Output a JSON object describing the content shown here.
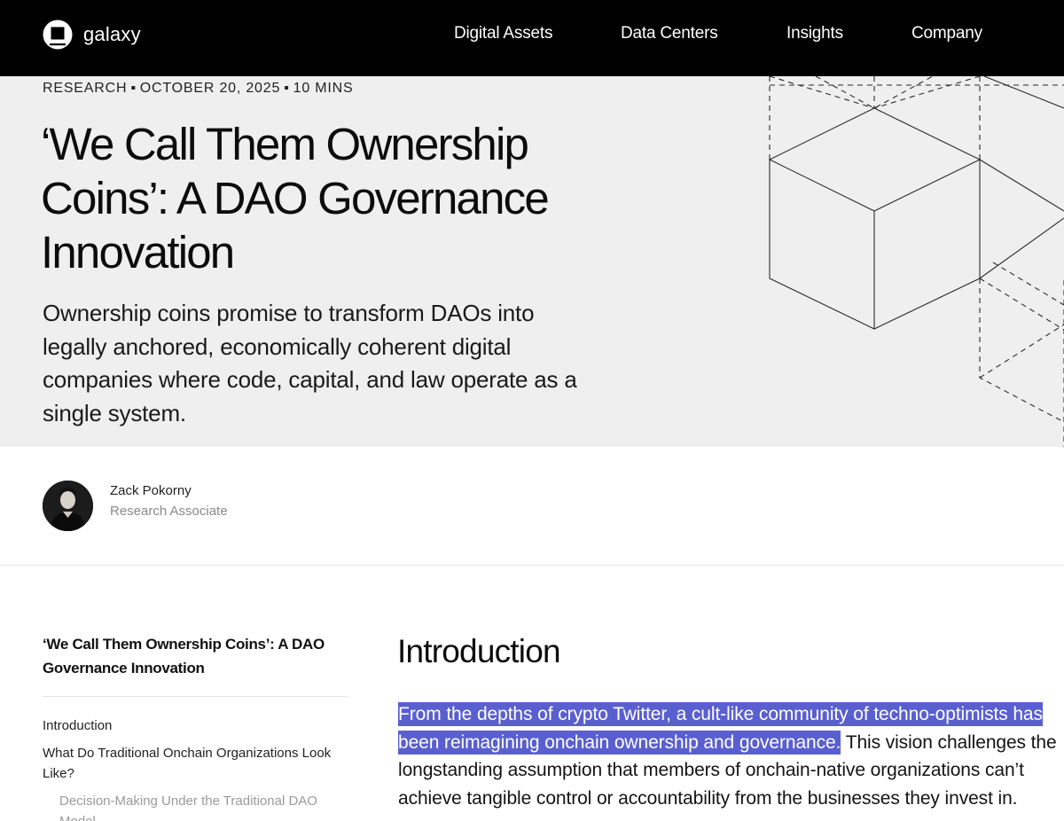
{
  "nav": {
    "brand": "galaxy",
    "links": [
      "Digital Assets",
      "Data Centers",
      "Insights",
      "Company"
    ]
  },
  "hero": {
    "category": "RESEARCH",
    "date": "OCTOBER 20, 2025",
    "read_time": "10 MINS",
    "title": "‘We Call Them Ownership Coins’: A DAO Governance Innovation",
    "subtitle": "Ownership coins promise to transform DAOs into legally anchored, economically coherent digital companies where code, capital, and law operate as a single system."
  },
  "author": {
    "name": "Zack Pokorny",
    "role": "Research Associate"
  },
  "toc": {
    "title": "‘We Call Them Ownership Coins’: A DAO Governance Innovation",
    "items": [
      "Introduction",
      "What Do Traditional Onchain Organizations Look Like?",
      "Decision-Making Under the Traditional DAO Model"
    ]
  },
  "content": {
    "heading": "Introduction",
    "highlighted": "From the depths of crypto Twitter, a cult-like community of techno-optimists has been reimagining onchain ownership and governance.",
    "rest": " This vision challenges the longstanding assumption that members of onchain-native organizations can’t achieve tangible control or accountability from the businesses they invest in."
  },
  "colors": {
    "nav_bg": "#000000",
    "hero_bg": "#efefef",
    "highlight": "#5a5fcf"
  }
}
